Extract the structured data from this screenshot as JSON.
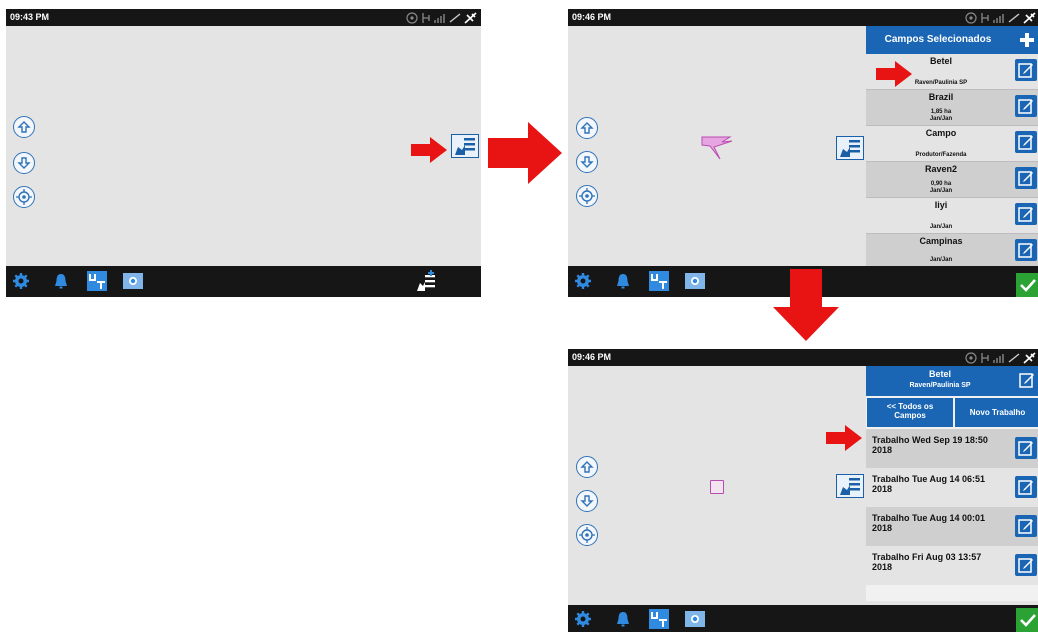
{
  "screens": [
    {
      "time": "09:43 PM"
    },
    {
      "time": "09:46 PM"
    },
    {
      "time": "09:46 PM"
    }
  ],
  "field_panel": {
    "title": "Campos Selecionados",
    "fields": [
      {
        "name": "Betel",
        "info": "Raven/Paulinia SP"
      },
      {
        "name": "Brazil",
        "info": "1,85 ha\nJan/Jan"
      },
      {
        "name": "Campo",
        "info": "Produtor/Fazenda"
      },
      {
        "name": "Raven2",
        "info": "0,90 ha\nJan/Jan"
      },
      {
        "name": "Iiyi",
        "info": "Jan/Jan"
      },
      {
        "name": "Campinas",
        "info": "Jan/Jan"
      }
    ]
  },
  "job_panel": {
    "field_name": "Betel",
    "field_info": "Raven/Paulinia SP",
    "back_label": "<< Todos os Campos",
    "new_job_label": "Novo Trabalho",
    "jobs": [
      {
        "label": "Trabalho Wed Sep 19 18:50 2018"
      },
      {
        "label": "Trabalho Tue Aug 14 06:51 2018"
      },
      {
        "label": "Trabalho Tue Aug 14 00:01 2018"
      },
      {
        "label": "Trabalho Fri Aug 03 13:57 2018"
      }
    ]
  },
  "colors": {
    "accent_blue": "#1a66b5",
    "arrow_red": "#e81414",
    "confirm_green": "#2aa334",
    "bar_dark": "#161616"
  },
  "icons": [
    "settings-gear-icon",
    "alarm-bell-icon",
    "ut-icon",
    "camera-icon",
    "zoom-in-icon",
    "zoom-out-icon",
    "center-target-icon",
    "field-map-icon",
    "edit-icon",
    "add-plus-icon",
    "checkmark-icon"
  ]
}
